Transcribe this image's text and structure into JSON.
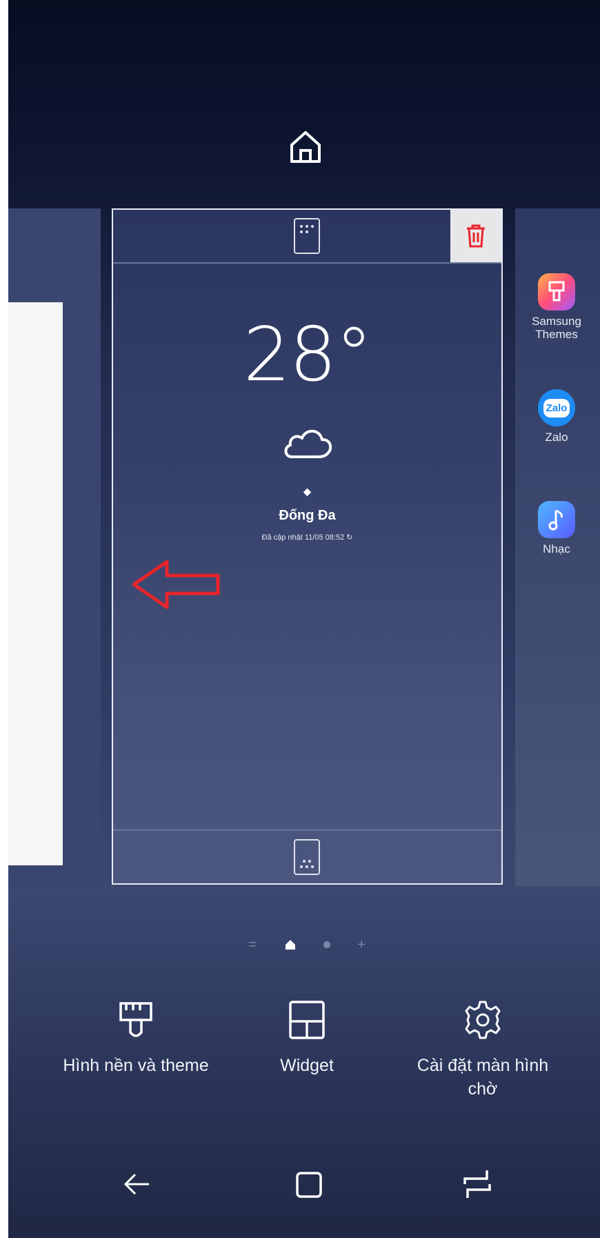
{
  "app_drawer": {
    "icons": [
      {
        "name": "Samsung Themes",
        "color": "#ff5a7a"
      },
      {
        "name": "Zalo",
        "color": "#1e8cf5",
        "badge": "Zalo"
      },
      {
        "name": "Nhạc",
        "color": "#4f70ff"
      }
    ]
  },
  "widget": {
    "temperature": "28°",
    "location_marker": "◆",
    "location": "Đống Đa",
    "updated": "Đã cập nhật 11/05 08:52"
  },
  "bottom_menu": {
    "wallpaper_label": "Hình nền và theme",
    "widget_label": "Widget",
    "settings_label": "Cài đặt màn hình chờ"
  },
  "colors": {
    "annotation_arrow": "#e8242c",
    "delete_icon": "#e8242c"
  }
}
